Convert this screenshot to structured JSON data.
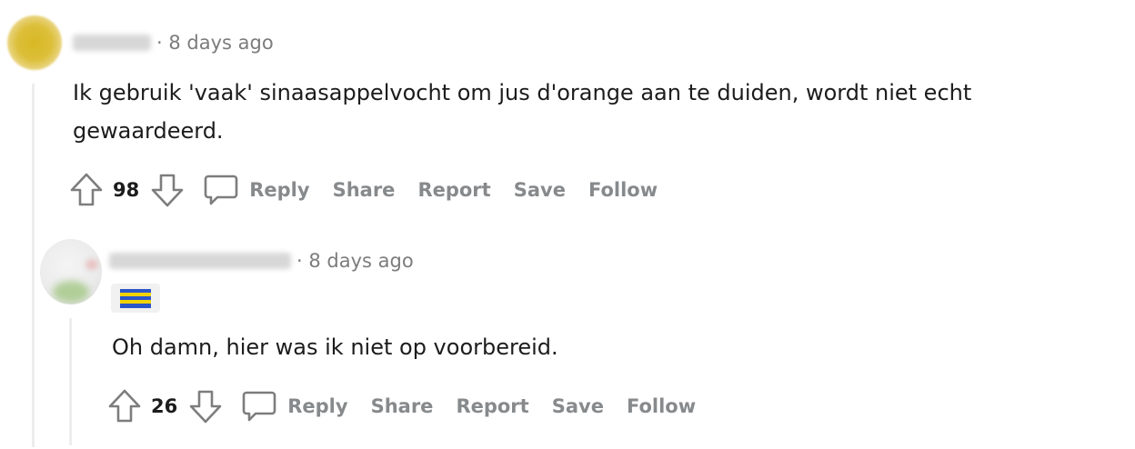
{
  "comments": [
    {
      "time": "8 days ago",
      "separator": "·",
      "body": "Ik gebruik 'vaak' sinaasappelvocht om jus d'orange aan te duiden, wordt niet echt gewaardeerd.",
      "score": "98",
      "actions": {
        "reply": "Reply",
        "share": "Share",
        "report": "Report",
        "save": "Save",
        "follow": "Follow"
      }
    },
    {
      "time": "8 days ago",
      "separator": "·",
      "body": "Oh damn, hier was ik niet op voorbereid.",
      "score": "26",
      "actions": {
        "reply": "Reply",
        "share": "Share",
        "report": "Report",
        "save": "Save",
        "follow": "Follow"
      }
    }
  ],
  "colors": {
    "avatar1": "#dcbf3a",
    "flair_flag_blue": "#2b56c9",
    "flair_flag_yellow": "#f2d300"
  },
  "icons": [
    "upvote-icon",
    "downvote-icon",
    "comment-icon",
    "flag-icon"
  ]
}
